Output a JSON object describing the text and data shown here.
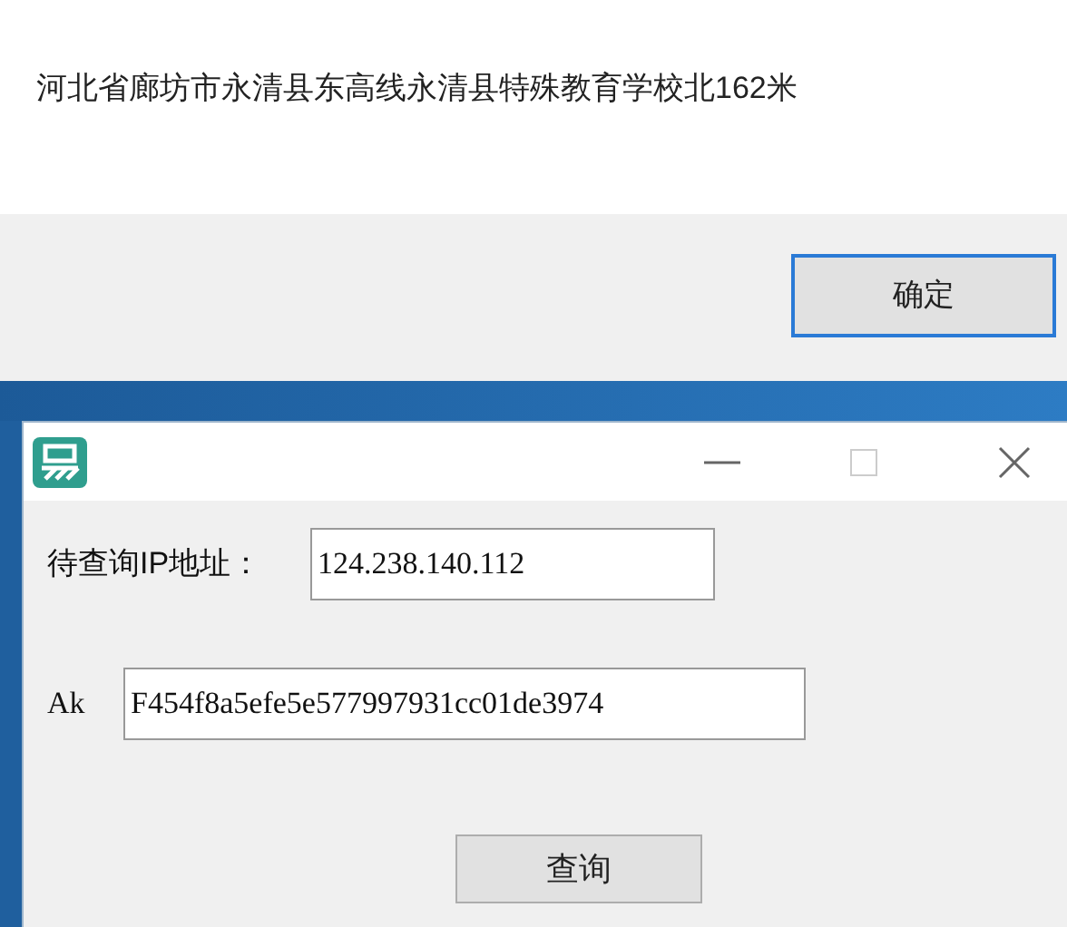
{
  "message_box": {
    "text": "河北省廊坊市永清县东高线永清县特殊教育学校北162米",
    "ok_button": "确定"
  },
  "window": {
    "fields": [
      {
        "label": "待查询IP地址：",
        "value": "124.238.140.112"
      },
      {
        "label": "Ak",
        "value": "F454f8a5efe5e577997931cc01de3974"
      }
    ],
    "query_button": "查询"
  }
}
